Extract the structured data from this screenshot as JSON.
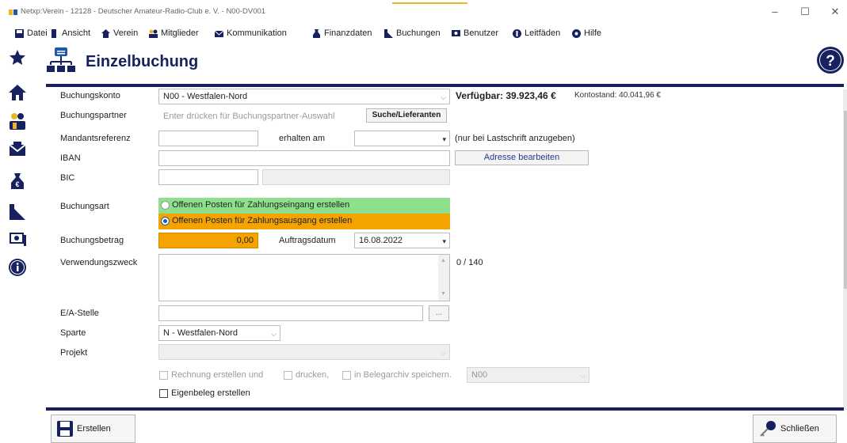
{
  "window": {
    "title": "Netxp:Verein - 12128 - Deutscher Amateur-Radio-Club e. V. - N00-DV001",
    "controls": {
      "minimize": "–",
      "maximize": "☐",
      "close": "✕"
    }
  },
  "menu": {
    "items": [
      {
        "label": "Datei",
        "icon": "disk-icon"
      },
      {
        "label": "Ansicht",
        "icon": "view-icon"
      },
      {
        "label": "Verein",
        "icon": "house-icon"
      },
      {
        "label": "Mitglieder",
        "icon": "members-icon"
      },
      {
        "label": "Kommunikation",
        "icon": "mail-icon"
      },
      {
        "label": "Finanzdaten",
        "icon": "money-bag-icon"
      },
      {
        "label": "Buchungen",
        "icon": "bookings-icon"
      },
      {
        "label": "Benutzer",
        "icon": "user-icon"
      },
      {
        "label": "Leitfäden",
        "icon": "guide-icon"
      },
      {
        "label": "Hilfe",
        "icon": "help-icon"
      }
    ]
  },
  "header": {
    "title": "Einzelbuchung",
    "help_glyph": "?"
  },
  "colors": {
    "navy": "#17215f",
    "accent": "#1e5aa8",
    "green": "#8fe08c",
    "orange": "#f5a300"
  },
  "form": {
    "buchungskonto": {
      "label": "Buchungskonto",
      "value": "N00 - Westfalen-Nord"
    },
    "balance": {
      "verfuegbar": "Verfügbar: 39.923,46 €",
      "kontostand": "Kontostand: 40.041,96 €"
    },
    "buchungspartner": {
      "label": "Buchungspartner",
      "placeholder": "Enter drücken für Buchungspartner-Auswahl",
      "button": "Suche/Lieferanten"
    },
    "mandatsreferenz": {
      "label": "Mandantsreferenz",
      "value": ""
    },
    "erhalten_am": {
      "label": "erhalten am",
      "value": ""
    },
    "lastschrift_hint": "(nur bei Lastschrift anzugeben)",
    "iban": {
      "label": "IBAN",
      "value": ""
    },
    "adresse_button": "Adresse bearbeiten",
    "bic": {
      "label": "BIC",
      "value": ""
    },
    "buchungsart": {
      "label": "Buchungsart",
      "options": [
        {
          "label": "Offenen Posten für Zahlungseingang erstellen",
          "selected": false
        },
        {
          "label": "Offenen Posten für Zahlungsausgang erstellen",
          "selected": true
        }
      ]
    },
    "buchungsbetrag": {
      "label": "Buchungsbetrag",
      "value": "0,00"
    },
    "auftragsdatum": {
      "label": "Auftragsdatum",
      "value": "16.08.2022"
    },
    "verwendungszweck": {
      "label": "Verwendungszweck",
      "value": "",
      "counter": "0 / 140"
    },
    "ea_stelle": {
      "label": "E/A-Stelle",
      "value": "",
      "button": "..."
    },
    "sparte": {
      "label": "Sparte",
      "value": "N - Westfalen-Nord"
    },
    "projekt": {
      "label": "Projekt",
      "value": ""
    },
    "checks": {
      "rechnung": "Rechnung erstellen und",
      "drucken": "drucken,",
      "belegarchiv": "in Belegarchiv speichern.",
      "archiv_select": "N00",
      "eigenbeleg": "Eigenbeleg erstellen"
    }
  },
  "footer": {
    "erstellen": "Erstellen",
    "schliessen": "Schließen"
  }
}
